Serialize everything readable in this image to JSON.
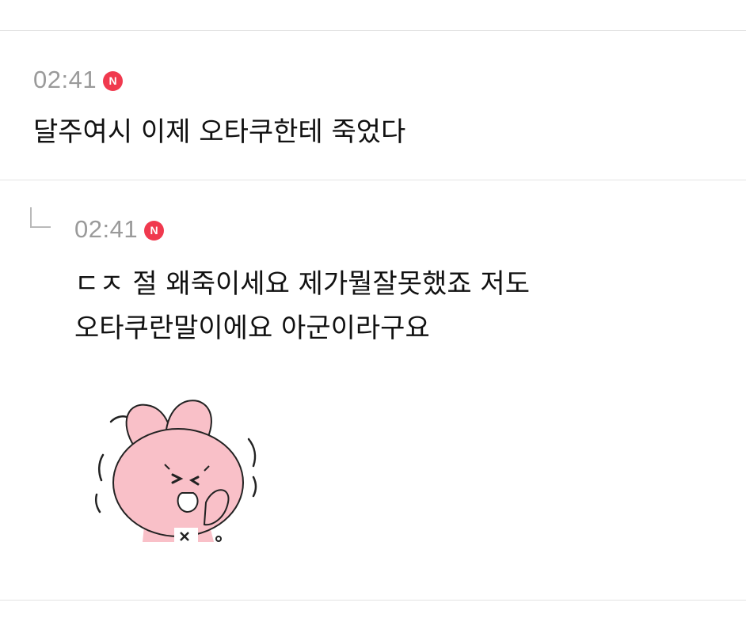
{
  "comments": [
    {
      "time": "02:41",
      "badge": "N",
      "text": "달주여시 이제 오타쿠한테 죽었다"
    }
  ],
  "reply": {
    "time": "02:41",
    "badge": "N",
    "text": "ㄷㅈ 절 왜죽이세요 제가뭘잘못했죠 저도\n오타쿠란말이에요 아군이라구요",
    "sticker": "crying-pink-bunny-sticker"
  },
  "colors": {
    "badge": "#f0394e",
    "time": "#9a9a9a",
    "divider": "#e3e3e3",
    "text": "#111111",
    "bunny": "#f9c0c8"
  }
}
